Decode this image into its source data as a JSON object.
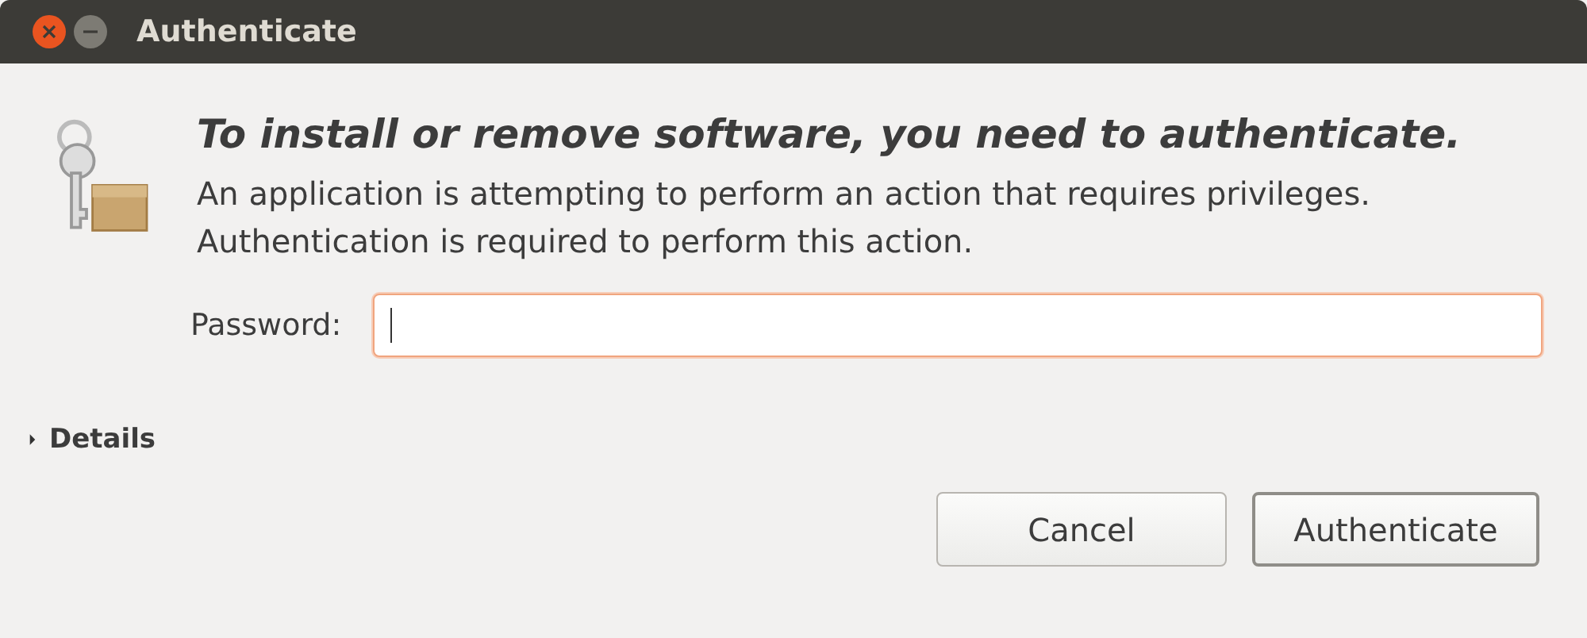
{
  "window": {
    "title": "Authenticate",
    "controls": [
      {
        "kind": "close"
      },
      {
        "kind": "minimize"
      }
    ]
  },
  "heading": "To install or remove software, you need to authenticate.",
  "message": "An application is attempting to perform an action that requires privileges. Authentication is required to perform this action.",
  "password": {
    "label": "Password:",
    "focused": true
  },
  "details": {
    "label": "Details",
    "expanded": false
  },
  "buttons": [
    {
      "label": "Cancel",
      "default": false
    },
    {
      "label": "Authenticate",
      "default": true
    }
  ]
}
